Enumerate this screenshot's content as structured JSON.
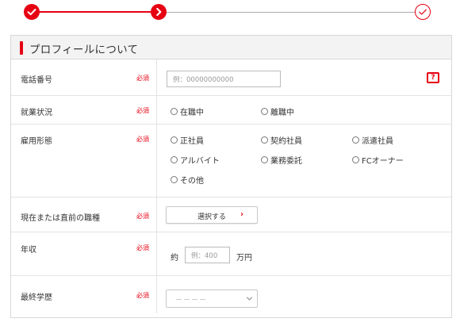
{
  "steps": {
    "items": [
      {
        "state": "done",
        "icon": "check-icon"
      },
      {
        "state": "current",
        "icon": "chevron-right-icon"
      },
      {
        "state": "todo",
        "icon": "check-outline-icon"
      }
    ],
    "colors": {
      "accent": "#e60012",
      "inactive": "#aaaaaa"
    }
  },
  "section": {
    "title": "プロフィールについて"
  },
  "required_label": "必須",
  "fields": {
    "phone": {
      "label": "電話番号",
      "placeholder": "例：00000000000",
      "help_icon": "question-icon",
      "help_text": "?"
    },
    "employment_status": {
      "label": "就業状況",
      "options": [
        "在職中",
        "離職中"
      ]
    },
    "employment_type": {
      "label": "雇用形態",
      "options": [
        "正社員",
        "契約社員",
        "派遣社員",
        "アルバイト",
        "業務委託",
        "FCオーナー",
        "その他"
      ]
    },
    "job_type": {
      "label": "現在または直前の職種",
      "button_label": "選択する",
      "button_icon": "chevron-right-icon",
      "button_glyph": "›"
    },
    "income": {
      "label": "年収",
      "prefix": "約",
      "placeholder": "例：400",
      "unit": "万円"
    },
    "education": {
      "label": "最終学歴",
      "selected": "－－－－",
      "icon": "chevron-down-icon"
    }
  }
}
